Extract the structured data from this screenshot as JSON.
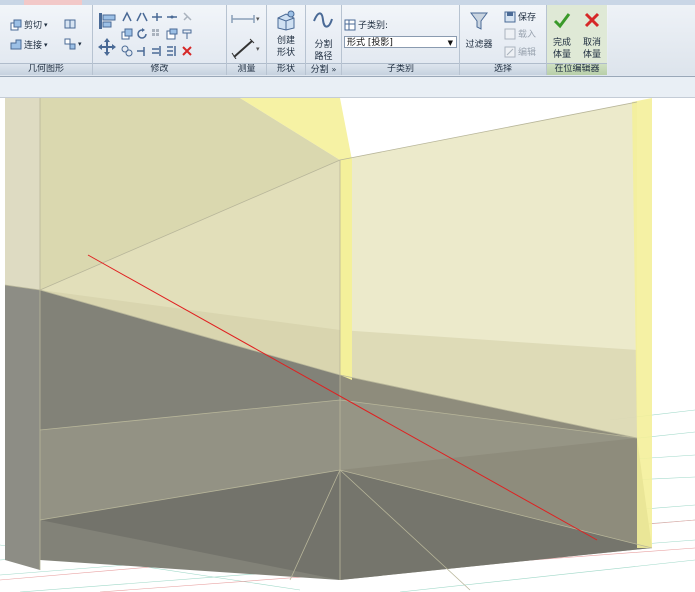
{
  "panels": {
    "geometry": {
      "label": "几何图形",
      "cut": "剪切",
      "join": "连接"
    },
    "modify": {
      "label": "修改"
    },
    "measure": {
      "label": "测量"
    },
    "form": {
      "label": "形状",
      "create_form": [
        "创建",
        "形状"
      ]
    },
    "divide": {
      "label": "分割",
      "arrow": "»",
      "divide_path": [
        "分割",
        "路径"
      ]
    },
    "subcategory": {
      "label": "子类别",
      "title": "子类别:",
      "value": "形式 [投影]"
    },
    "select": {
      "label": "选择",
      "filter": "过滤器",
      "save": "保存",
      "load": "载入",
      "edit": "编辑"
    },
    "inplace": {
      "label": "在位编辑器",
      "finish": [
        "完成",
        "体量"
      ],
      "cancel": [
        "取消",
        "体量"
      ]
    }
  },
  "colors": {
    "ribbon_top": "#f3f6fa",
    "ribbon_bottom": "#dfe6ef",
    "finish_check": "#3a9a2a",
    "cancel_x": "#d62828",
    "mass_fill": "#e8e6b6",
    "mass_edge": "#f4f09a",
    "cut_line": "#e02020"
  }
}
